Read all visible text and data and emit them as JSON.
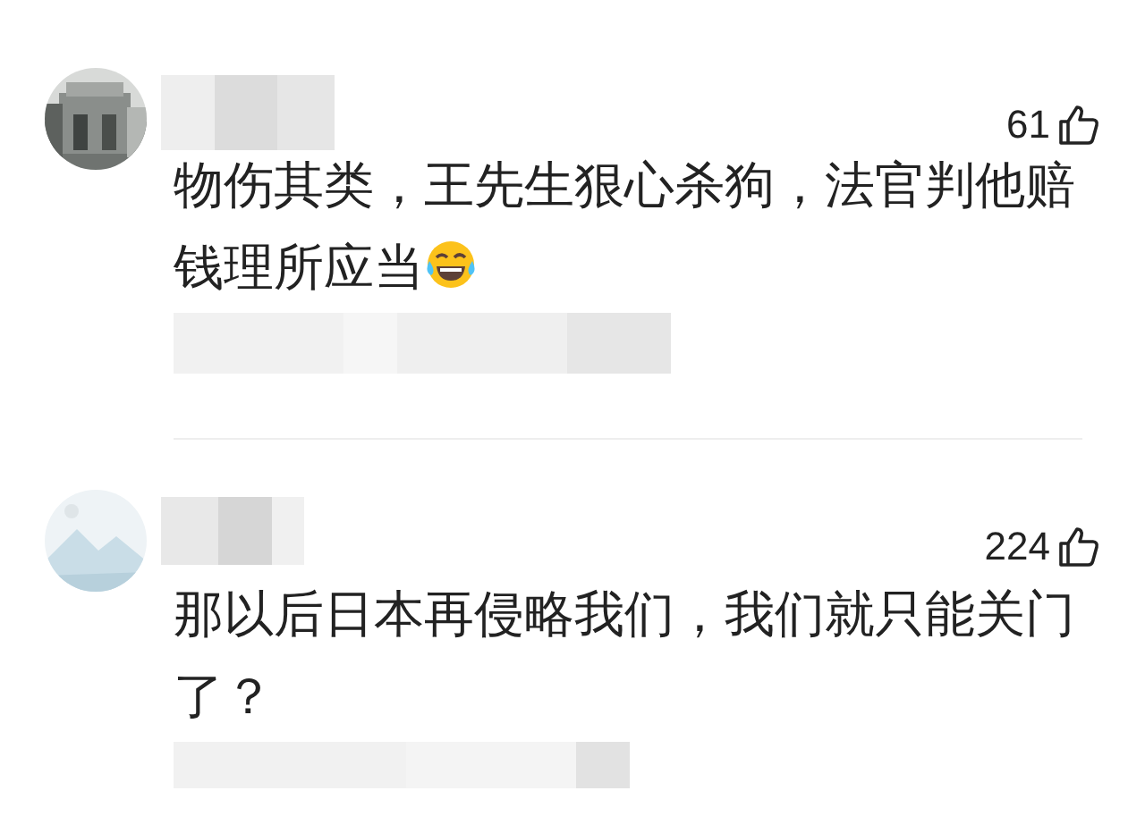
{
  "comments": [
    {
      "likes": "61",
      "text": "物伤其类，王先生狠心杀狗，法官判他赔钱理所应当",
      "laughing_emoji": true
    },
    {
      "likes": "224",
      "text": "那以后日本再侵略我们，我们就只能关门了？",
      "laughing_emoji": false
    }
  ]
}
